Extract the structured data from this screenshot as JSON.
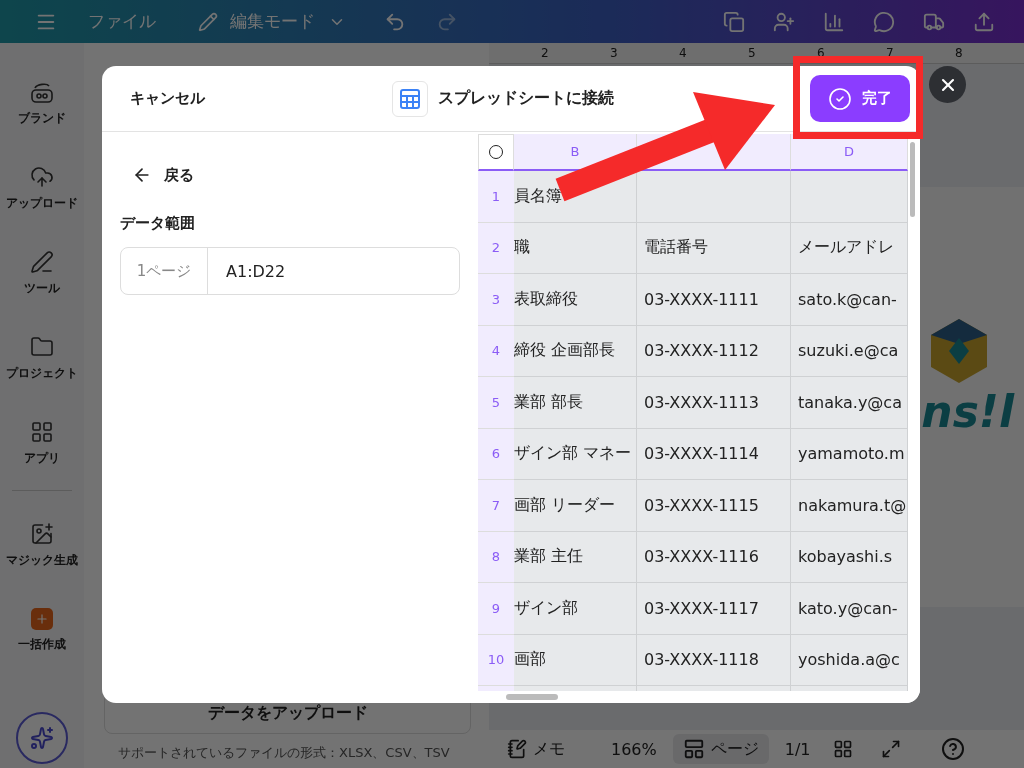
{
  "top_bar": {
    "file": "ファイル",
    "mode": "編集モード"
  },
  "sidebar": {
    "items": [
      {
        "kind": "brand",
        "label": "ブランド"
      },
      {
        "kind": "upload",
        "label": "アップロード"
      },
      {
        "kind": "tools",
        "label": "ツール"
      },
      {
        "kind": "projects",
        "label": "プロジェクト"
      },
      {
        "kind": "apps",
        "label": "アプリ"
      },
      {
        "kind": "magic",
        "label": "マジック生成"
      },
      {
        "kind": "bulk",
        "label": "一括作成"
      }
    ]
  },
  "side_panel": {
    "upload_button": "データをアップロード",
    "supported_formats": "サポートされているファイルの形式：XLSX、CSV、TSV"
  },
  "ruler": [
    "2",
    "3",
    "4",
    "5",
    "6",
    "7",
    "8"
  ],
  "canvas": {
    "logo_text": "ns!l"
  },
  "bottom_bar": {
    "notes": "メモ",
    "zoom": "166%",
    "pages": "ページ",
    "page_count": "1/1"
  },
  "dialog": {
    "cancel": "キャンセル",
    "title": "スプレッドシートに接続",
    "done": "完了",
    "back": "戻る",
    "range_label": "データ範囲",
    "range_field": {
      "prefix": "1ページ",
      "value": "A1:D22"
    },
    "sheet": {
      "columns": [
        {
          "label": "B",
          "selected": true
        },
        {
          "selected": true
        },
        {
          "label": "D",
          "selected": true
        }
      ],
      "rows": [
        {
          "number": "1",
          "cells": [
            {
              "text": "員名簿"
            },
            {},
            {}
          ]
        },
        {
          "number": "2",
          "cells": [
            {
              "text": "職"
            },
            {
              "text": "電話番号"
            },
            {
              "text": "メールアドレ"
            }
          ]
        },
        {
          "number": "3",
          "cells": [
            {
              "text": "表取締役"
            },
            {
              "text": "03-XXXX-1111"
            },
            {
              "text": "sato.k@can-"
            }
          ]
        },
        {
          "number": "4",
          "cells": [
            {
              "text": "締役 企画部長"
            },
            {
              "text": "03-XXXX-1112"
            },
            {
              "text": "suzuki.e@ca"
            }
          ]
        },
        {
          "number": "5",
          "cells": [
            {
              "text": "業部 部長"
            },
            {
              "text": "03-XXXX-1113"
            },
            {
              "text": "tanaka.y@ca"
            }
          ]
        },
        {
          "number": "6",
          "cells": [
            {
              "text": "ザイン部 マネー"
            },
            {
              "text": "03-XXXX-1114"
            },
            {
              "text": "yamamoto.m"
            }
          ]
        },
        {
          "number": "7",
          "cells": [
            {
              "text": "画部 リーダー"
            },
            {
              "text": "03-XXXX-1115"
            },
            {
              "text": "nakamura.t@"
            }
          ]
        },
        {
          "number": "8",
          "cells": [
            {
              "text": "業部 主任"
            },
            {
              "text": "03-XXXX-1116"
            },
            {
              "text": "kobayashi.s"
            }
          ]
        },
        {
          "number": "9",
          "cells": [
            {
              "text": "ザイン部"
            },
            {
              "text": "03-XXXX-1117"
            },
            {
              "text": "kato.y@can-"
            }
          ]
        },
        {
          "number": "10",
          "cells": [
            {
              "text": "画部"
            },
            {
              "text": "03-XXXX-1118"
            },
            {
              "text": "yoshida.a@c"
            }
          ]
        }
      ]
    }
  }
}
